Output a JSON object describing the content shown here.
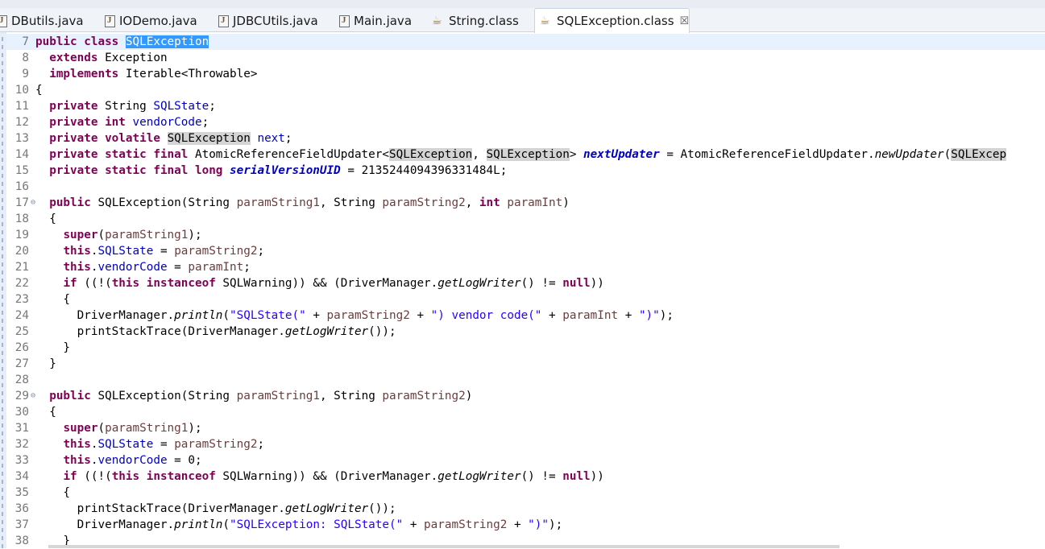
{
  "tabs": [
    {
      "label": "DButils.java",
      "icon": "java-file-icon"
    },
    {
      "label": "IODemo.java",
      "icon": "java-file-icon"
    },
    {
      "label": "JDBCUtils.java",
      "icon": "java-file-icon"
    },
    {
      "label": "Main.java",
      "icon": "java-file-icon"
    },
    {
      "label": "String.class",
      "icon": "class-file-icon"
    },
    {
      "label": "SQLException.class",
      "icon": "class-file-icon",
      "active": true,
      "close": "☒"
    }
  ],
  "editor": {
    "lines": [
      {
        "n": "7",
        "t": [
          [
            "kw",
            "public class"
          ],
          [
            "",
            ""
          ],
          [
            "sel",
            "SQLException"
          ]
        ]
      },
      {
        "n": "8",
        "t": [
          [
            "",
            "  "
          ],
          [
            "kw",
            "extends"
          ],
          [
            "",
            " Exception"
          ]
        ]
      },
      {
        "n": "9",
        "t": [
          [
            "",
            "  "
          ],
          [
            "kw",
            "implements"
          ],
          [
            "",
            " Iterable<Throwable>"
          ]
        ]
      },
      {
        "n": "10",
        "t": [
          [
            "",
            "{"
          ]
        ]
      },
      {
        "n": "11",
        "t": [
          [
            "",
            "  "
          ],
          [
            "kw",
            "private"
          ],
          [
            "",
            " String "
          ],
          [
            "fd",
            "SQLState"
          ],
          [
            "",
            ";"
          ]
        ]
      },
      {
        "n": "12",
        "t": [
          [
            "",
            "  "
          ],
          [
            "kw",
            "private int"
          ],
          [
            "",
            " "
          ],
          [
            "fd",
            "vendorCode"
          ],
          [
            "",
            ";"
          ]
        ]
      },
      {
        "n": "13",
        "t": [
          [
            "",
            "  "
          ],
          [
            "kw",
            "private volatile"
          ],
          [
            "",
            " "
          ],
          [
            "occ",
            "SQLException"
          ],
          [
            "",
            " "
          ],
          [
            "fd",
            "next"
          ],
          [
            "",
            ";"
          ]
        ]
      },
      {
        "n": "14",
        "t": [
          [
            "",
            "  "
          ],
          [
            "kw",
            "private static final"
          ],
          [
            "",
            " AtomicReferenceFieldUpdater<"
          ],
          [
            "occ",
            "SQLException"
          ],
          [
            "",
            ", "
          ],
          [
            "occ",
            "SQLException"
          ],
          [
            "",
            "> "
          ],
          [
            "sfd",
            "nextUpdater"
          ],
          [
            "",
            " = AtomicReferenceFieldUpdater."
          ],
          [
            "it",
            "newUpdater"
          ],
          [
            "",
            "("
          ],
          [
            "occ",
            "SQLExcep"
          ]
        ]
      },
      {
        "n": "15",
        "t": [
          [
            "",
            "  "
          ],
          [
            "kw",
            "private static final long"
          ],
          [
            "",
            " "
          ],
          [
            "sfd",
            "serialVersionUID"
          ],
          [
            "",
            " = 2135244094396331484L;"
          ]
        ]
      },
      {
        "n": "16",
        "t": []
      },
      {
        "n": "17",
        "fold": "⊖",
        "t": [
          [
            "",
            "  "
          ],
          [
            "kw",
            "public"
          ],
          [
            "",
            " SQLException(String "
          ],
          [
            "pr",
            "paramString1"
          ],
          [
            "",
            ", String "
          ],
          [
            "pr",
            "paramString2"
          ],
          [
            "",
            ", "
          ],
          [
            "kw",
            "int"
          ],
          [
            "",
            " "
          ],
          [
            "pr",
            "paramInt"
          ],
          [
            "",
            ")"
          ]
        ]
      },
      {
        "n": "18",
        "t": [
          [
            "",
            "  {"
          ]
        ]
      },
      {
        "n": "19",
        "t": [
          [
            "",
            "    "
          ],
          [
            "kw",
            "super"
          ],
          [
            "",
            "("
          ],
          [
            "pr",
            "paramString1"
          ],
          [
            "",
            ");"
          ]
        ]
      },
      {
        "n": "20",
        "t": [
          [
            "",
            "    "
          ],
          [
            "kw",
            "this"
          ],
          [
            "",
            "."
          ],
          [
            "fd",
            "SQLState"
          ],
          [
            "",
            " = "
          ],
          [
            "pr",
            "paramString2"
          ],
          [
            "",
            ";"
          ]
        ]
      },
      {
        "n": "21",
        "t": [
          [
            "",
            "    "
          ],
          [
            "kw",
            "this"
          ],
          [
            "",
            "."
          ],
          [
            "fd",
            "vendorCode"
          ],
          [
            "",
            " = "
          ],
          [
            "pr",
            "paramInt"
          ],
          [
            "",
            ";"
          ]
        ]
      },
      {
        "n": "22",
        "t": [
          [
            "",
            "    "
          ],
          [
            "kw",
            "if"
          ],
          [
            "",
            " ((!("
          ],
          [
            "kw",
            "this instanceof"
          ],
          [
            "",
            " SQLWarning)) && (DriverManager."
          ],
          [
            "it",
            "getLogWriter"
          ],
          [
            "",
            "() != "
          ],
          [
            "kw",
            "null"
          ],
          [
            "",
            "))"
          ]
        ]
      },
      {
        "n": "23",
        "t": [
          [
            "",
            "    {"
          ]
        ]
      },
      {
        "n": "24",
        "t": [
          [
            "",
            "      DriverManager."
          ],
          [
            "it",
            "println"
          ],
          [
            "",
            "("
          ],
          [
            "str",
            "\"SQLState(\""
          ],
          [
            "",
            " + "
          ],
          [
            "pr",
            "paramString2"
          ],
          [
            "",
            " + "
          ],
          [
            "str",
            "\") vendor code(\""
          ],
          [
            "",
            " + "
          ],
          [
            "pr",
            "paramInt"
          ],
          [
            "",
            " + "
          ],
          [
            "str",
            "\")\""
          ],
          [
            "",
            ");"
          ]
        ]
      },
      {
        "n": "25",
        "t": [
          [
            "",
            "      printStackTrace(DriverManager."
          ],
          [
            "it",
            "getLogWriter"
          ],
          [
            "",
            "());"
          ]
        ]
      },
      {
        "n": "26",
        "t": [
          [
            "",
            "    }"
          ]
        ]
      },
      {
        "n": "27",
        "t": [
          [
            "",
            "  }"
          ]
        ]
      },
      {
        "n": "28",
        "t": []
      },
      {
        "n": "29",
        "fold": "⊖",
        "t": [
          [
            "",
            "  "
          ],
          [
            "kw",
            "public"
          ],
          [
            "",
            " SQLException(String "
          ],
          [
            "pr",
            "paramString1"
          ],
          [
            "",
            ", String "
          ],
          [
            "pr",
            "paramString2"
          ],
          [
            "",
            ")"
          ]
        ]
      },
      {
        "n": "30",
        "t": [
          [
            "",
            "  {"
          ]
        ]
      },
      {
        "n": "31",
        "t": [
          [
            "",
            "    "
          ],
          [
            "kw",
            "super"
          ],
          [
            "",
            "("
          ],
          [
            "pr",
            "paramString1"
          ],
          [
            "",
            ");"
          ]
        ]
      },
      {
        "n": "32",
        "t": [
          [
            "",
            "    "
          ],
          [
            "kw",
            "this"
          ],
          [
            "",
            "."
          ],
          [
            "fd",
            "SQLState"
          ],
          [
            "",
            " = "
          ],
          [
            "pr",
            "paramString2"
          ],
          [
            "",
            ";"
          ]
        ]
      },
      {
        "n": "33",
        "t": [
          [
            "",
            "    "
          ],
          [
            "kw",
            "this"
          ],
          [
            "",
            "."
          ],
          [
            "fd",
            "vendorCode"
          ],
          [
            "",
            " = 0;"
          ]
        ]
      },
      {
        "n": "34",
        "t": [
          [
            "",
            "    "
          ],
          [
            "kw",
            "if"
          ],
          [
            "",
            " ((!("
          ],
          [
            "kw",
            "this instanceof"
          ],
          [
            "",
            " SQLWarning)) && (DriverManager."
          ],
          [
            "it",
            "getLogWriter"
          ],
          [
            "",
            "() != "
          ],
          [
            "kw",
            "null"
          ],
          [
            "",
            "))"
          ]
        ]
      },
      {
        "n": "35",
        "t": [
          [
            "",
            "    {"
          ]
        ]
      },
      {
        "n": "36",
        "t": [
          [
            "",
            "      printStackTrace(DriverManager."
          ],
          [
            "it",
            "getLogWriter"
          ],
          [
            "",
            "());"
          ]
        ]
      },
      {
        "n": "37",
        "t": [
          [
            "",
            "      DriverManager."
          ],
          [
            "it",
            "println"
          ],
          [
            "",
            "("
          ],
          [
            "str",
            "\"SQLException: SQLState(\""
          ],
          [
            "",
            " + "
          ],
          [
            "pr",
            "paramString2"
          ],
          [
            "",
            " + "
          ],
          [
            "str",
            "\")\""
          ],
          [
            "",
            ");"
          ]
        ]
      },
      {
        "n": "38",
        "t": [
          [
            "",
            "    }"
          ]
        ]
      }
    ]
  }
}
